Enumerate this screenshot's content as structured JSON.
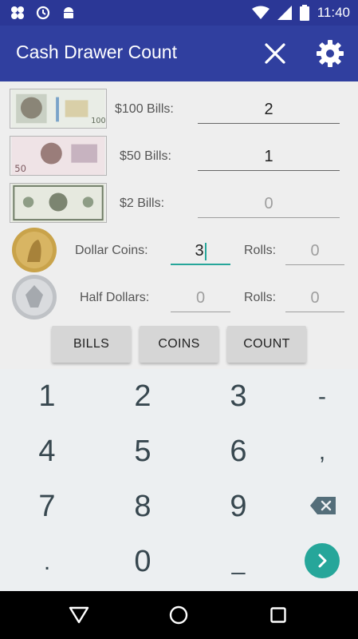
{
  "status_bar": {
    "time": "11:40",
    "icons_left": [
      "pinwheel-icon",
      "sync-icon",
      "android-icon"
    ],
    "icons_right": [
      "wifi-icon",
      "cell-signal-icon",
      "battery-icon"
    ]
  },
  "app_bar": {
    "title": "Cash Drawer Count",
    "actions": [
      "close-icon",
      "settings-gear-icon"
    ]
  },
  "rows": {
    "hundred": {
      "label": "$100 Bills:",
      "value": "2",
      "placeholder": "0"
    },
    "fifty": {
      "label": "$50 Bills:",
      "value": "1",
      "placeholder": "0"
    },
    "two": {
      "label": "$2 Bills:",
      "value": "",
      "placeholder": "0"
    },
    "dollar_coins": {
      "label": "Dollar Coins:",
      "value": "3",
      "rolls_label": "Rolls:",
      "rolls_value": "",
      "rolls_placeholder": "0"
    },
    "half_dollars": {
      "label": "Half Dollars:",
      "value": "",
      "placeholder": "0",
      "rolls_label": "Rolls:",
      "rolls_value": "",
      "rolls_placeholder": "0"
    }
  },
  "buttons": {
    "bills": "BILLS",
    "coins": "COINS",
    "count": "COUNT"
  },
  "keyboard": {
    "keys": [
      "1",
      "2",
      "3",
      "-",
      "4",
      "5",
      "6",
      ",",
      "7",
      "8",
      "9",
      "backspace-icon",
      ".",
      "0",
      "_",
      "enter-icon"
    ],
    "accent": "#26a69a"
  },
  "nav_bar": {
    "icons": [
      "back-icon",
      "home-icon",
      "recents-icon"
    ]
  },
  "colors": {
    "app_bar": "#303f9f",
    "status_bar": "#2b3796",
    "accent": "#26a69a"
  }
}
